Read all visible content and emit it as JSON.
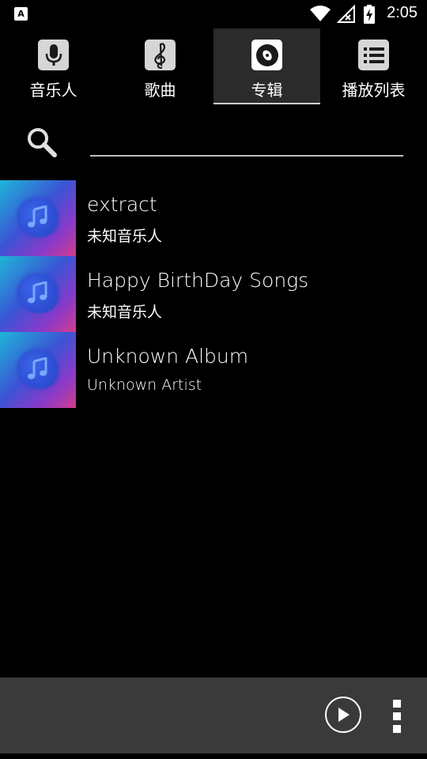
{
  "status_bar": {
    "time": "2:05",
    "notification_icon_letter": "A"
  },
  "tabs": [
    {
      "label": "音乐人",
      "icon": "microphone-icon",
      "selected": false
    },
    {
      "label": "歌曲",
      "icon": "treble-clef-icon",
      "selected": false
    },
    {
      "label": "专辑",
      "icon": "disc-icon",
      "selected": true
    },
    {
      "label": "播放列表",
      "icon": "list-icon",
      "selected": false
    }
  ],
  "search": {
    "value": "",
    "placeholder": ""
  },
  "albums": [
    {
      "title": "extract",
      "artist": "未知音乐人"
    },
    {
      "title": "Happy BirthDay Songs",
      "artist": "未知音乐人"
    },
    {
      "title": "Unknown Album",
      "artist": "Unknown Artist"
    }
  ],
  "player": {
    "play_icon": "play-icon",
    "more_icon": "more-vertical-icon"
  },
  "colors": {
    "background": "#000000",
    "player_bar": "#3a3a3a",
    "tab_selected": "#2b2b2b"
  }
}
